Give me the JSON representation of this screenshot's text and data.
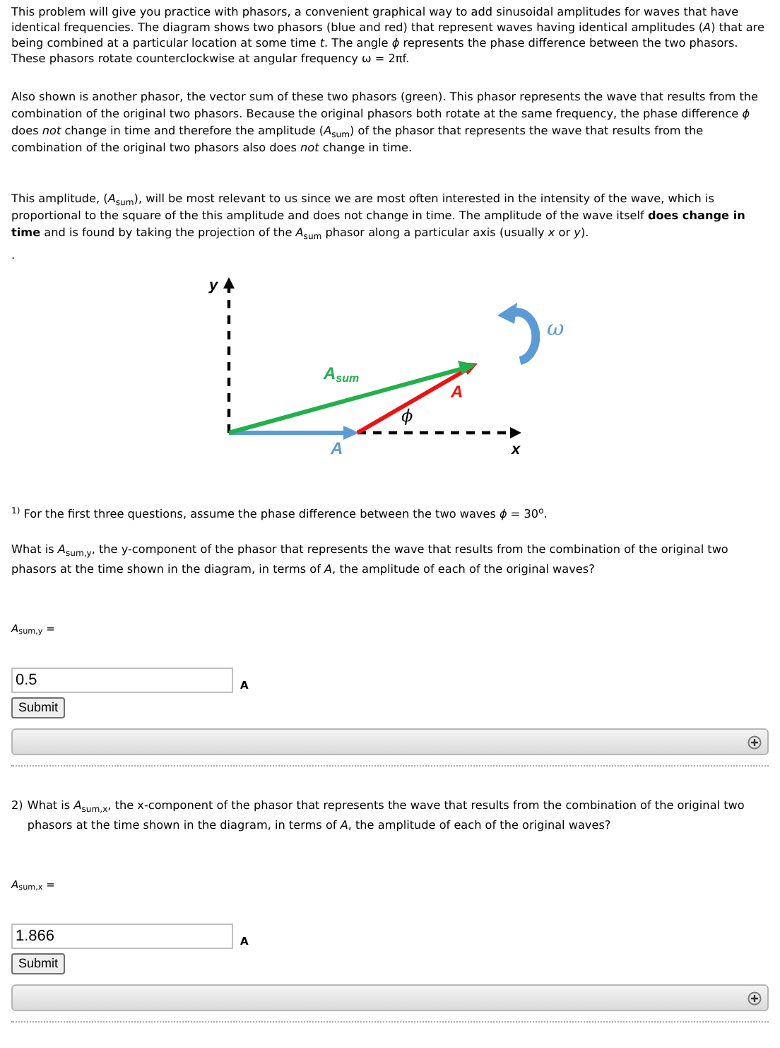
{
  "paragraphs": [
    "This problem will give you practice with phasors, a convenient graphical way to add sinusoidal amplitudes for waves that have identical frequencies. The diagram shows two phasors (blue and red) that represent waves having identical amplitudes (*A*) that are being combined at a particular location at some time *t*. The angle *ϕ* represents the phase difference between the two phasors. These phasors rotate counterclockwise at angular frequency ω = 2πf.",
    "Also shown is another phasor, the vector sum of these two phasors (green). This phasor represents the wave that results from the combination of the original two phasors. Because the original phasors both rotate at the same frequency, the phase difference *ϕ* does *not* change in time and therefore the amplitude (*A*$_{sum}$) of the phasor that represents the wave that results from the combination of the original two phasors also does *not* change in time.",
    "This amplitude, (*A*$_{sum}$), will be most relevant to us since we are most often interested in the intensity of the wave, which is proportional to the square of the this amplitude and does not change in time. The amplitude of the wave itself **does change in time** and is found by taking the projection of the *A*$_{sum}$ phasor along a particular axis (usually *x* or *y*)."
  ],
  "stray_mark": ".",
  "diagram": {
    "y_label": "y",
    "x_label": "x",
    "sum_label": "A",
    "sum_sub": "sum",
    "red_label": "A",
    "blue_label": "A",
    "angle_label": "ϕ",
    "omega_label": "ω"
  },
  "questions": [
    {
      "intro": "$^{1)}$ For the first three questions, assume the phase difference between the two waves *ϕ* = 30$^{o}$.",
      "prompt": "What is *A*$_{sum,y}$, the y-component of the phasor that represents the wave that results from the combination of the original two phasors at the time shown in the diagram, in terms of *A*, the amplitude of each of the original waves?",
      "answer_label": "*A*$_{sum,y}$ =",
      "value": "0.5",
      "unit": "A",
      "button": "Submit"
    },
    {
      "number": "2)",
      "prompt": "What is *A*$_{sum,x}$, the x-component of the phasor that represents the wave that results from the combination of the original two phasors at the time shown in the diagram, in terms of *A*, the amplitude of each of the original waves?",
      "answer_label": "*A*$_{sum,x}$ =",
      "value": "1.866",
      "unit": "A",
      "button": "Submit"
    }
  ]
}
